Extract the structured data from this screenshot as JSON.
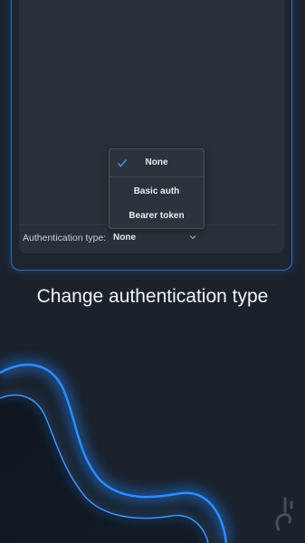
{
  "settings": {
    "auth_type_label": "Authentication type:",
    "auth_type_value": "None"
  },
  "dropdown": {
    "options": [
      "None",
      "Basic auth",
      "Bearer token"
    ],
    "selected_index": 0
  },
  "caption": "Change authentication type",
  "colors": {
    "background": "#1b222c",
    "accent_blue": "#2f8cff",
    "checkmark": "#3d8fe0"
  }
}
